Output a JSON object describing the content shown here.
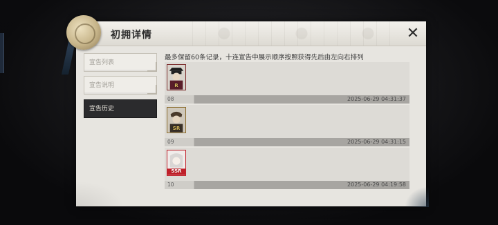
{
  "dialog": {
    "title": "初拥详情",
    "close_icon": "close-icon",
    "seal_icon": "wax-seal-icon"
  },
  "tabs": [
    {
      "label": "宣告列表",
      "active": false
    },
    {
      "label": "宣告说明",
      "active": false
    },
    {
      "label": "宣告历史",
      "active": true
    }
  ],
  "history": {
    "notice": "最多保留60条记录，十连宣告中展示顺序按照获得先后由左向右排列",
    "entries": [
      {
        "number": "08",
        "time": "2025-06-29 04:31:37",
        "card": {
          "rank": "R",
          "icon": "character-portrait-icon",
          "border_color": "#7a2a2a"
        }
      },
      {
        "number": "09",
        "time": "2025-06-29 04:31:15",
        "card": {
          "rank": "SR",
          "icon": "character-portrait-icon",
          "border_color": "#8a6a2a"
        }
      },
      {
        "number": "10",
        "time": "2025-06-29 04:19:58",
        "card": {
          "rank": "SSR",
          "icon": "character-portrait-icon",
          "border_color": "#c0202a"
        }
      }
    ]
  },
  "colors": {
    "dialog_bg": "#e7e5e0",
    "active_tab": "#2b2b2d",
    "entry_bar": "#a7a5a1"
  }
}
